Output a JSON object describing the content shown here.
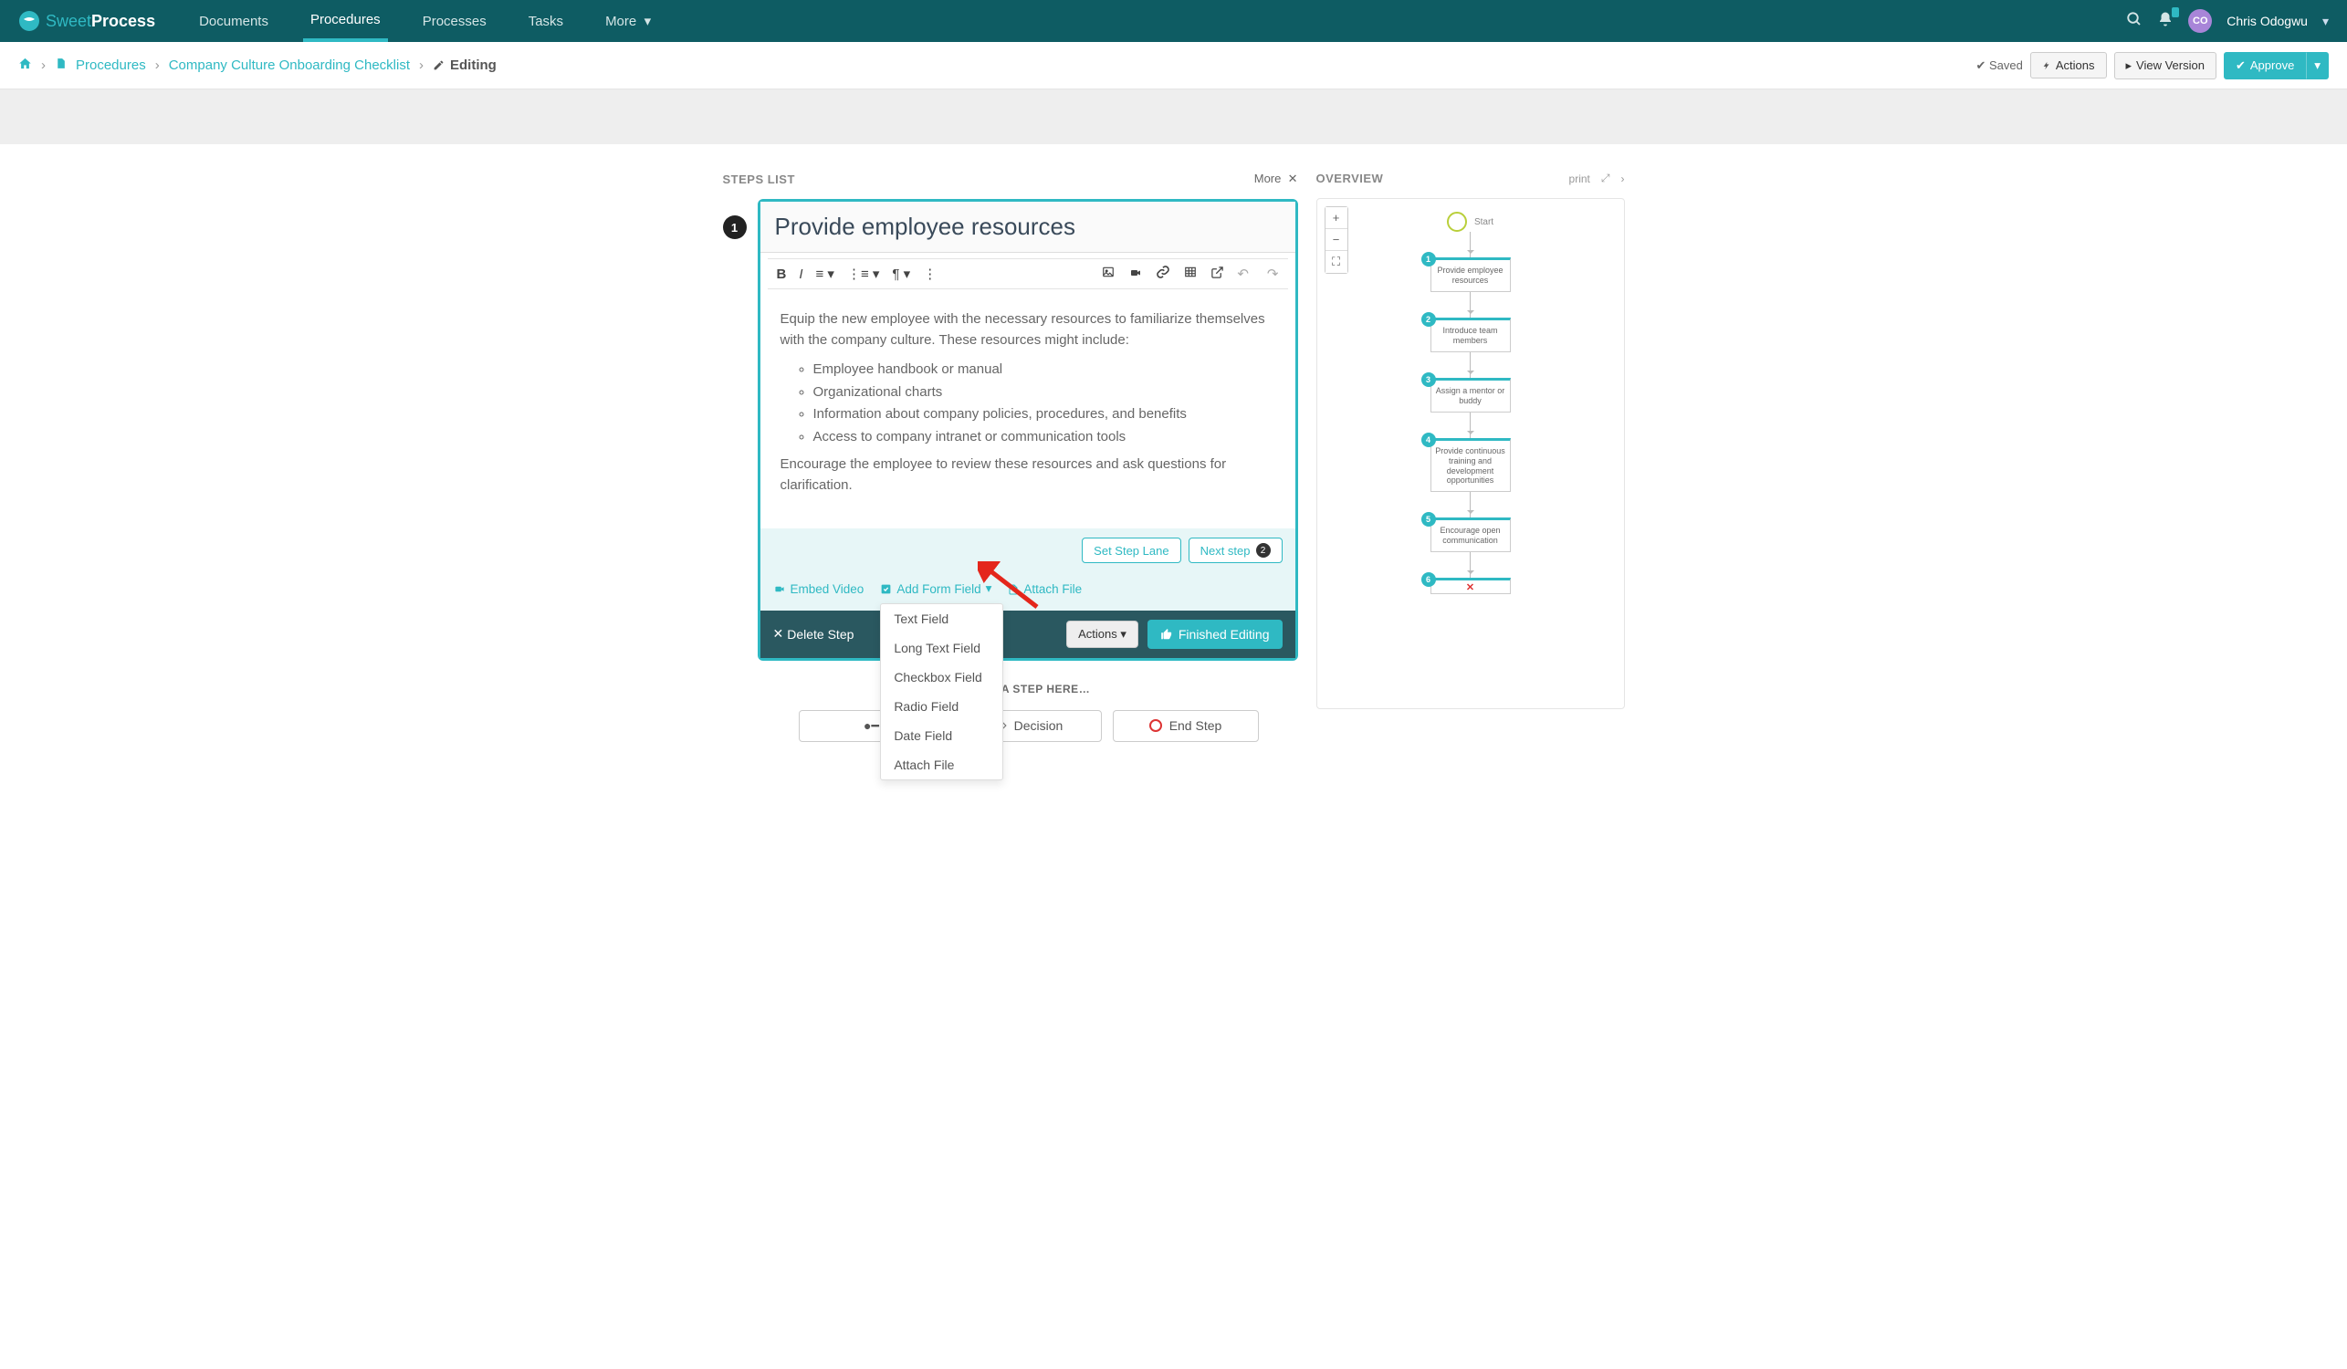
{
  "brand": {
    "light": "Sweet",
    "bold": "Process"
  },
  "nav": {
    "documents": "Documents",
    "procedures": "Procedures",
    "processes": "Processes",
    "tasks": "Tasks",
    "more": "More"
  },
  "user": {
    "initials": "CO",
    "name": "Chris Odogwu"
  },
  "crumb": {
    "procedures": "Procedures",
    "title": "Company Culture Onboarding Checklist",
    "editing": "Editing"
  },
  "crumbActions": {
    "saved": "Saved",
    "actions": "Actions",
    "viewVersion": "View Version",
    "approve": "Approve"
  },
  "stepsList": {
    "heading": "STEPS LIST",
    "more": "More",
    "stepNumber": "1",
    "title": "Provide employee resources",
    "body": {
      "intro": "Equip the new employee with the necessary resources to familiarize themselves with the company culture. These resources might include:",
      "bullets": [
        "Employee handbook or manual",
        "Organizational charts",
        "Information about company policies, procedures, and benefits",
        "Access to company intranet or communication tools"
      ],
      "outro": "Encourage the employee to review these resources and ask questions for clarification."
    },
    "setLane": "Set Step Lane",
    "nextStep": "Next step",
    "nextStepNum": "2",
    "embedVideo": "Embed Video",
    "addFormField": "Add Form Field",
    "attachFile": "Attach File",
    "delete": "Delete Step",
    "actions": "Actions",
    "finished": "Finished Editing",
    "formFieldMenu": [
      "Text Field",
      "Long Text Field",
      "Checkbox Field",
      "Radio Field",
      "Date Field",
      "Attach File"
    ],
    "addHere": "… DD A STEP HERE…",
    "addDecision": "Decision",
    "addEnd": "End Step"
  },
  "overview": {
    "heading": "OVERVIEW",
    "print": "print",
    "start": "Start",
    "nodes": [
      {
        "n": "1",
        "label": "Provide employee resources"
      },
      {
        "n": "2",
        "label": "Introduce team members"
      },
      {
        "n": "3",
        "label": "Assign a mentor or buddy"
      },
      {
        "n": "4",
        "label": "Provide continuous training and development opportunities"
      },
      {
        "n": "5",
        "label": "Encourage open communication"
      },
      {
        "n": "6",
        "label": ""
      }
    ]
  }
}
